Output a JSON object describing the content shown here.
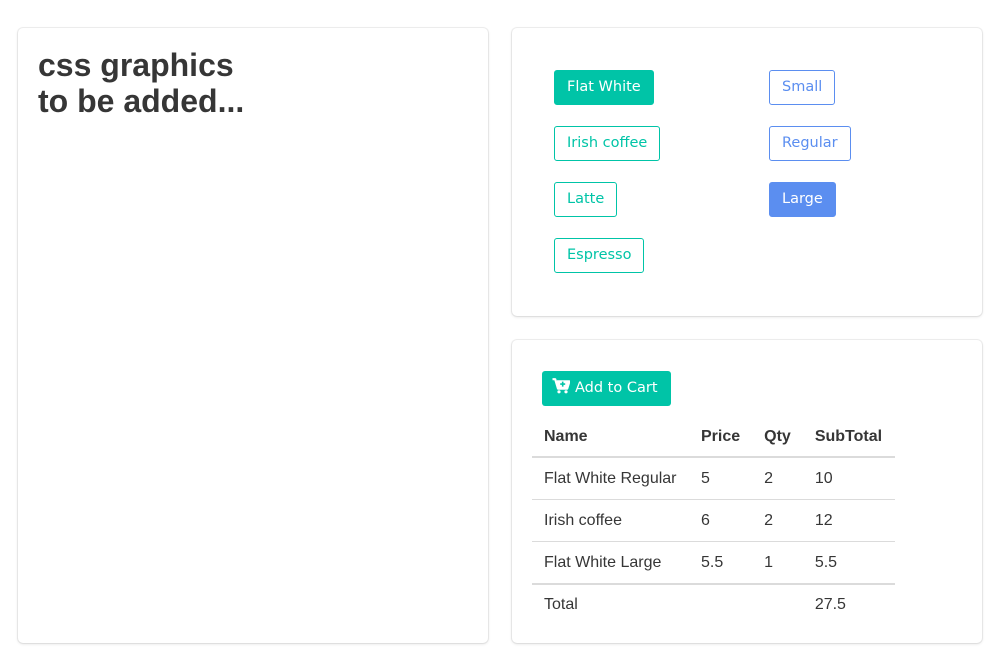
{
  "placeholder": {
    "line1": "css graphics",
    "line2": "to be added..."
  },
  "coffees": [
    {
      "label": "Flat White",
      "selected": true
    },
    {
      "label": "Irish coffee",
      "selected": false
    },
    {
      "label": "Latte",
      "selected": false
    },
    {
      "label": "Espresso",
      "selected": false
    }
  ],
  "sizes": [
    {
      "label": "Small",
      "selected": false
    },
    {
      "label": "Regular",
      "selected": false
    },
    {
      "label": "Large",
      "selected": true
    }
  ],
  "cart": {
    "add_button_label": "Add to Cart",
    "add_button_icon": "cart-plus-icon",
    "columns": [
      "Name",
      "Price",
      "Qty",
      "SubTotal"
    ],
    "rows": [
      {
        "name": "Flat White Regular",
        "price": "5",
        "qty": "2",
        "subtotal": "10"
      },
      {
        "name": "Irish coffee",
        "price": "6",
        "qty": "2",
        "subtotal": "12"
      },
      {
        "name": "Flat White Large",
        "price": "5.5",
        "qty": "1",
        "subtotal": "5.5"
      }
    ],
    "total_label": "Total",
    "total_value": "27.5"
  },
  "colors": {
    "coffee_accent": "#00c4a7",
    "size_accent": "#5b8ef0",
    "text": "#363636",
    "border": "#dbdbdb"
  }
}
